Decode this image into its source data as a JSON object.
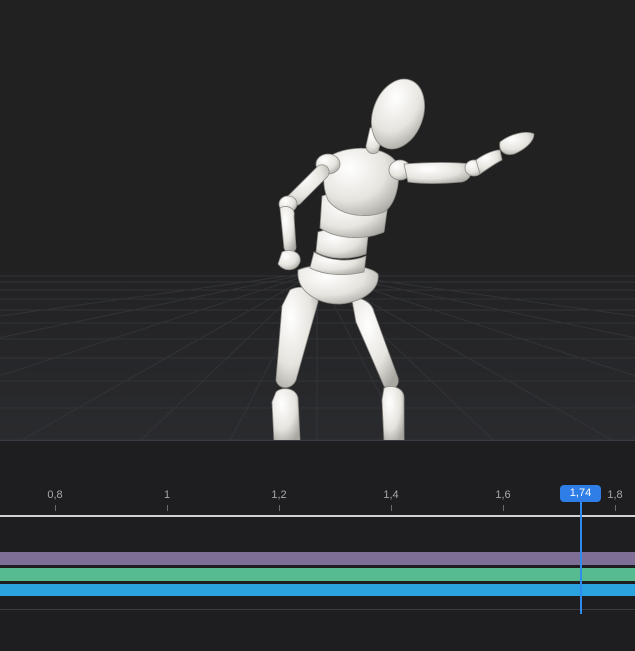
{
  "timeline": {
    "ticks": [
      "0,8",
      "1",
      "1,2",
      "1,4",
      "1,6",
      "1,8"
    ],
    "playhead_label": "1,74",
    "current_time": 1.74
  },
  "tracks": [
    {
      "name": "purple-track",
      "color": "#7e6f96"
    },
    {
      "name": "green-track",
      "color": "#56bc8f"
    },
    {
      "name": "blue-track",
      "color": "#2aa3df"
    }
  ],
  "scene": {
    "figure": "wooden-mannequin",
    "figure_color": "#e8e6e0",
    "floor_grid": true
  }
}
